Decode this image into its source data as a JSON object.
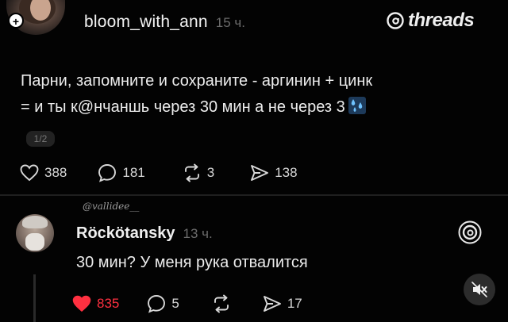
{
  "post": {
    "username": "bloom_with_ann",
    "time": "15 ч.",
    "brand": "threads",
    "plus_badge": "+",
    "text_line1": "Парни, запомните и сохраните - аргинин + цинк",
    "text_line2": "= и ты к@нчаншь через 30 мин а не через 3",
    "page_indicator": "1/2",
    "likes": "388",
    "comments": "181",
    "reposts": "3",
    "shares": "138"
  },
  "reply": {
    "via": "@vallidee__",
    "username": "Röckötansky",
    "time": "13 ч.",
    "text": "30 мин? У меня рука отвалится",
    "likes": "835",
    "comments": "5",
    "shares": "17",
    "like_color": "#ff3040"
  },
  "icons": {
    "threads_logo": "threads-logo-icon",
    "heart": "heart-icon",
    "comment": "comment-icon",
    "repost": "repost-icon",
    "share": "share-icon",
    "mute": "muted-speaker-icon",
    "water": "sweat-droplets-icon"
  }
}
